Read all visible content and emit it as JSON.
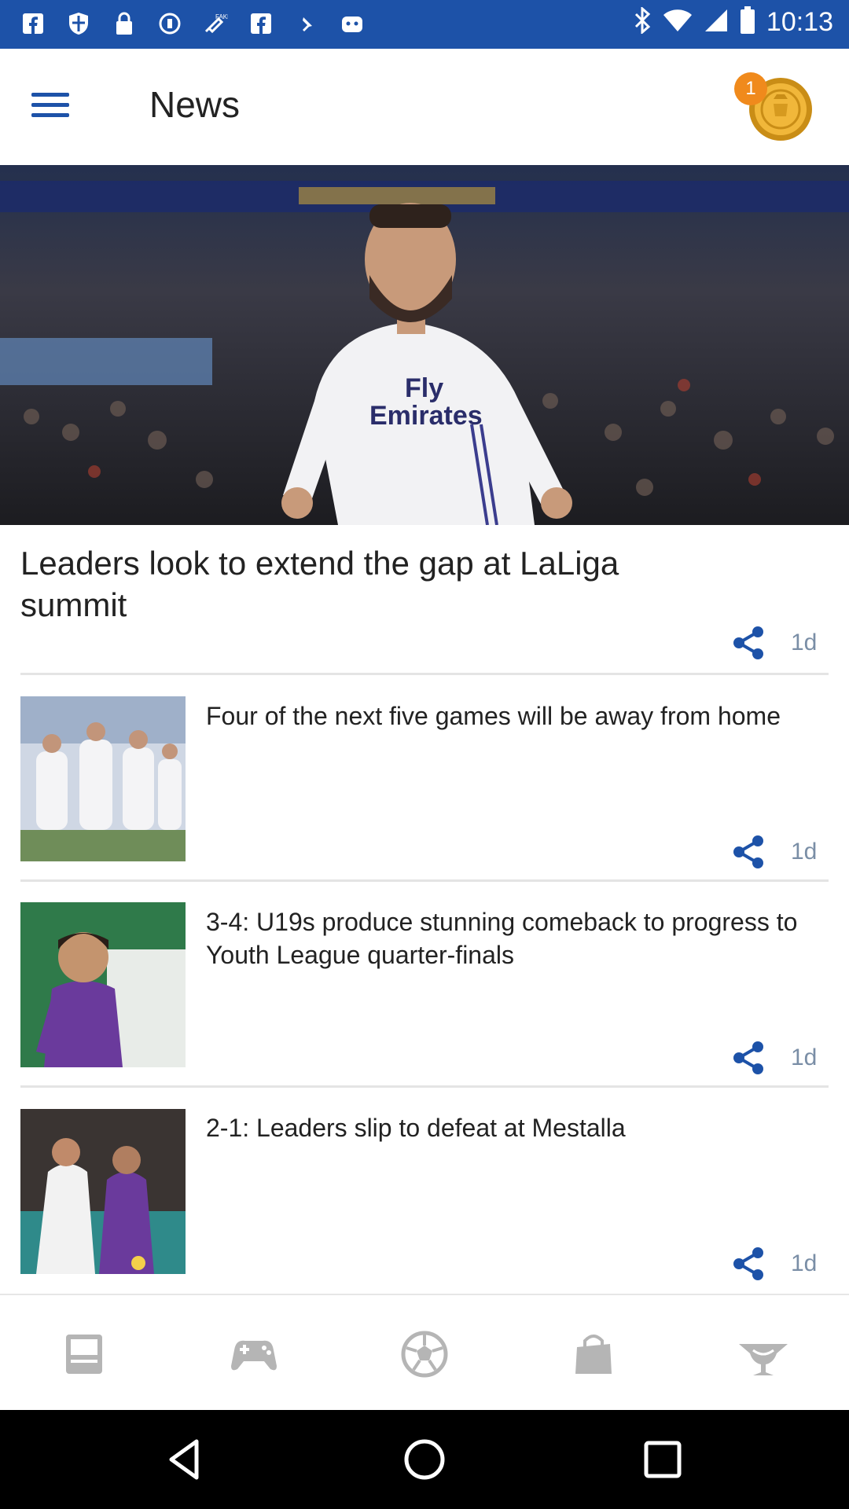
{
  "status_bar": {
    "time": "10:13",
    "left_icons": [
      "facebook-icon",
      "shield-icon",
      "lock-icon",
      "data-saver-icon",
      "fake-gps-icon",
      "facebook-icon",
      "pin-icon",
      "app-icon"
    ],
    "right_icons": [
      "bluetooth-icon",
      "wifi-icon",
      "signal-icon",
      "battery-icon"
    ]
  },
  "header": {
    "title": "News",
    "badge_count": "1"
  },
  "hero": {
    "title": "Leaders look to extend the gap at LaLiga summit",
    "age": "1d"
  },
  "articles": [
    {
      "title": "Four of the next five games will be away from home",
      "age": "1d"
    },
    {
      "title": "3-4: U19s produce stunning comeback to progress to Youth League quarter-finals",
      "age": "1d"
    },
    {
      "title": "2-1: Leaders slip to defeat at Mestalla",
      "age": "1d"
    }
  ],
  "bottom_nav": [
    "news-icon",
    "gamepad-icon",
    "football-icon",
    "shopping-bag-icon",
    "trophy-icon"
  ],
  "colors": {
    "brand_blue": "#1d52a8",
    "badge_orange": "#f08a1c",
    "meta_gray": "#7a8ea6",
    "nav_icon_gray": "#b5b5b5"
  }
}
